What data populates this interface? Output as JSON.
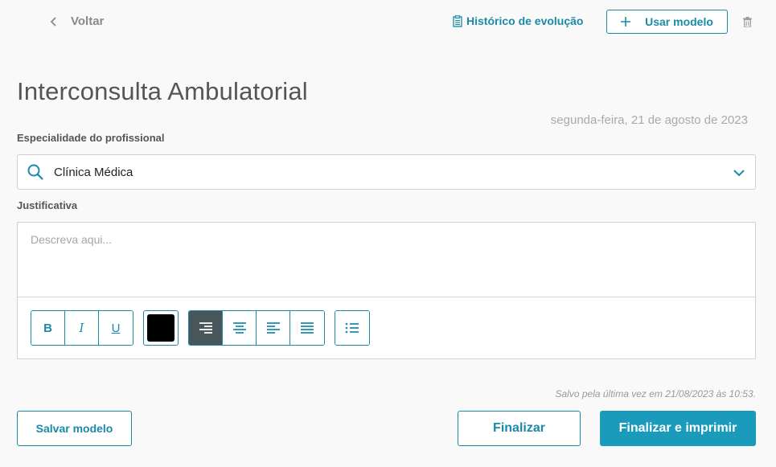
{
  "header": {
    "back_label": "Voltar",
    "history_label": "Histórico de evolução",
    "use_model_label": "Usar modelo"
  },
  "page": {
    "title": "Interconsulta Ambulatorial",
    "date": "segunda-feira, 21 de agosto de 2023"
  },
  "form": {
    "specialty_label": "Especialidade do profissional",
    "specialty_value": "Clínica Médica",
    "justification_label": "Justificativa",
    "justification_placeholder": "Descreva aqui..."
  },
  "toolbar": {
    "bold": "B",
    "italic": "I",
    "underline": "U",
    "text_color": "#000000",
    "active_alignment": "align-right"
  },
  "footer": {
    "saved_text": "Salvo pela última vez em 21/08/2023 às 10:53.",
    "save_model_label": "Salvar modelo",
    "finish_label": "Finalizar",
    "finish_print_label": "Finalizar e imprimir"
  },
  "colors": {
    "accent": "#1a8aa8",
    "primary_button": "#1a9bbb",
    "active_tool": "#4a545b"
  }
}
